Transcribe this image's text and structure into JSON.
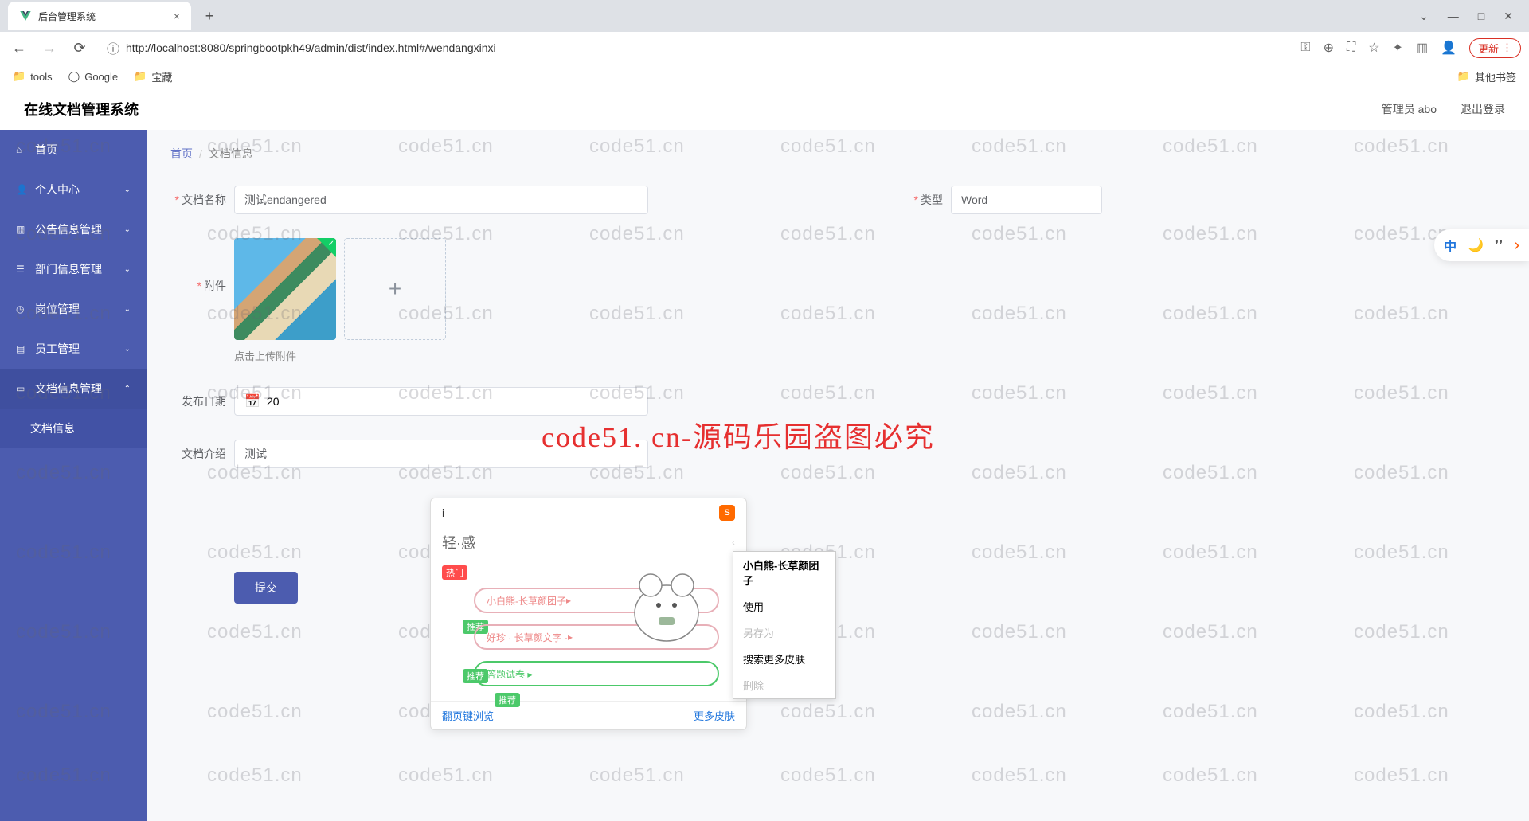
{
  "browser": {
    "tab_title": "后台管理系统",
    "url": "http://localhost:8080/springbootpkh49/admin/dist/index.html#/wendangxinxi",
    "update_label": "更新",
    "bookmarks": {
      "tools": "tools",
      "google": "Google",
      "treasure": "宝藏",
      "other": "其他书签"
    }
  },
  "header": {
    "app_title": "在线文档管理系统",
    "user": "管理员 abo",
    "logout": "退出登录"
  },
  "sidebar": {
    "home": "首页",
    "personal": "个人中心",
    "notice": "公告信息管理",
    "dept": "部门信息管理",
    "position": "岗位管理",
    "staff": "员工管理",
    "docmgr": "文档信息管理",
    "docinfo": "文档信息"
  },
  "breadcrumb": {
    "home": "首页",
    "current": "文档信息"
  },
  "form": {
    "doc_name_label": "文档名称",
    "doc_name_value": "测试endangered",
    "type_label": "类型",
    "type_value": "Word",
    "attach_label": "附件",
    "upload_hint": "点击上传附件",
    "pub_date_label": "发布日期",
    "pub_date_value": "20",
    "doc_intro_label": "文档介绍",
    "doc_intro_value": "测试",
    "submit": "提交"
  },
  "ime": {
    "input": "i",
    "suggestion": "轻·感",
    "hot_badge": "热门",
    "rec_badge": "推荐",
    "skin1": "小白熊-长草颜团子",
    "skin2": "好珍 · 长草颜文字 ·",
    "footer_left": "翻页键浏览",
    "footer_right": "更多皮肤",
    "context": {
      "title": "小白熊-长草颜团子",
      "use": "使用",
      "saveas": "另存为",
      "search": "搜索更多皮肤",
      "delete": "删除"
    }
  },
  "watermark_text": "code51.cn",
  "watermark_main": "code51. cn-源码乐园盗图必究",
  "toolbar": {
    "lang": "中"
  }
}
